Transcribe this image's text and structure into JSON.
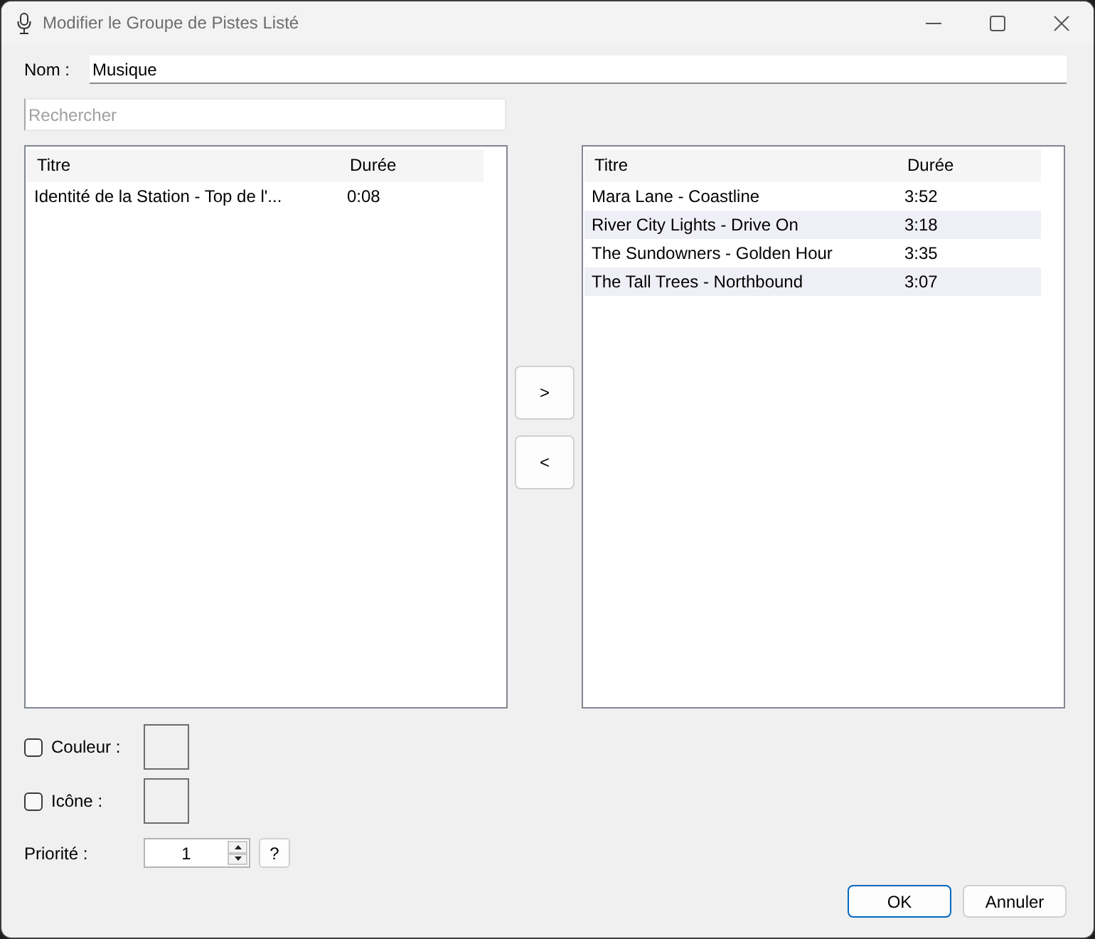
{
  "window": {
    "title": "Modifier le Groupe de Pistes Listé"
  },
  "name_field": {
    "label": "Nom :",
    "value": "Musique"
  },
  "search": {
    "placeholder": "Rechercher"
  },
  "available_list": {
    "columns": [
      "Titre",
      "Durée"
    ],
    "rows": [
      {
        "title": "Identité de la Station - Top de l'...",
        "duration": "0:08",
        "selected": false
      }
    ]
  },
  "transfer_buttons": [
    ">",
    "<"
  ],
  "assigned_list": {
    "columns": [
      "Titre",
      "Durée"
    ],
    "rows": [
      {
        "title": "Mara Lane - Coastline",
        "duration": "3:52",
        "selected": false
      },
      {
        "title": "River City Lights - Drive On",
        "duration": "3:18",
        "selected": false
      },
      {
        "title": "The Sundowners - Golden Hour",
        "duration": "3:35",
        "selected": false
      },
      {
        "title": "The Tall Trees - Northbound",
        "duration": "3:07",
        "selected": false
      }
    ]
  },
  "color_option": {
    "label": "Couleur :",
    "checked": false
  },
  "icon_option": {
    "label": "Icône :",
    "checked": false
  },
  "priority": {
    "label": "Priorité :",
    "value": "1",
    "help": "?"
  },
  "buttons": [
    {
      "label": "OK",
      "default": true
    },
    {
      "label": "Annuler",
      "default": false
    }
  ]
}
